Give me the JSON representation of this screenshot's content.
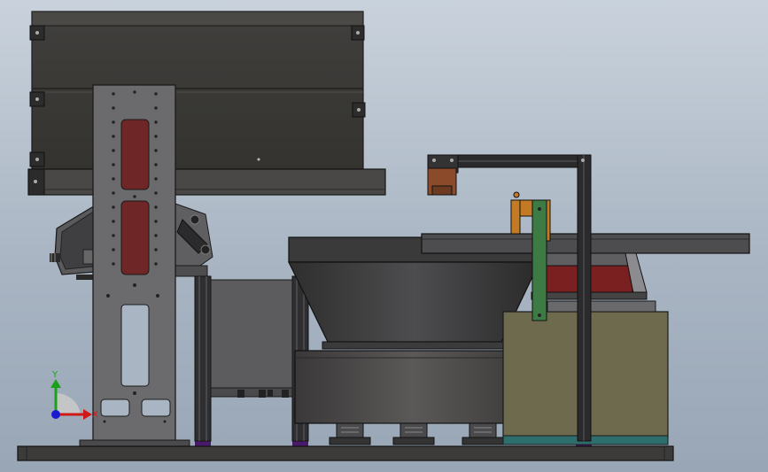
{
  "triad": {
    "y_label": "Y",
    "x_label": "X",
    "colors": {
      "x": "#d01818",
      "y": "#1aa11a",
      "z": "#1a1ad0"
    }
  },
  "palette": {
    "steel_dark": "#3b3a39",
    "steel_mid": "#56575a",
    "steel_light": "#6e6f72",
    "slot_red": "#6e2626",
    "rust": "#8b4a2a",
    "olive": "#6d6a4e",
    "bracket_orange": "#c27a25",
    "bracket_green": "#3e7a43",
    "teal_strip": "#2e6f6e",
    "purple_foot": "#4a1a6a"
  }
}
